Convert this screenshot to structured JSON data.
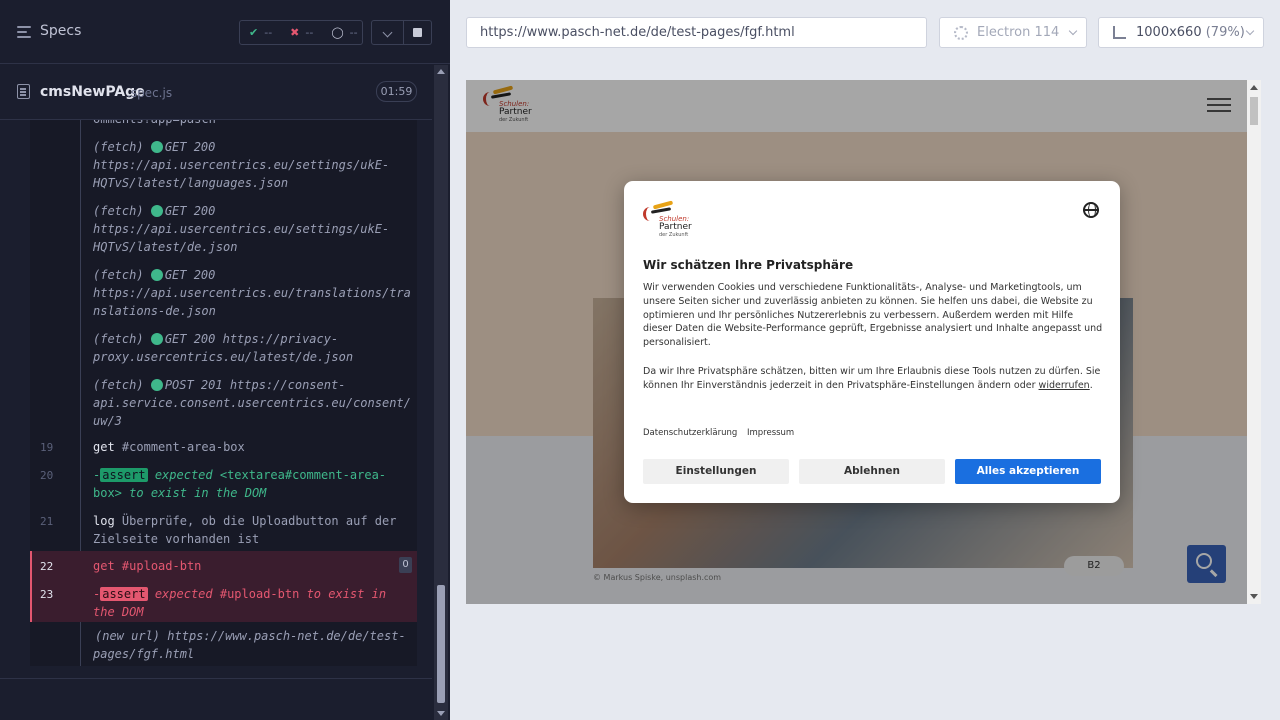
{
  "runner": {
    "specs_label": "Specs",
    "stats": {
      "passed": "--",
      "failed": "--",
      "pending": "--"
    },
    "spec_file": {
      "name": "cmsNewPAge",
      "ext": ".spec.js",
      "duration": "01:59"
    }
  },
  "log": {
    "l0": "omments?app=pasch",
    "fetch1a": "(fetch)",
    "fetch1b": "GET 200",
    "fetch1c": "https://api.usercentrics.eu/settings/ukE-",
    "fetch1d": "HQTvS/latest/languages.json",
    "fetch2b": "GET 200",
    "fetch2c": "https://api.usercentrics.eu/settings/ukE-",
    "fetch2d": "HQTvS/latest/de.json",
    "fetch3b": "GET 200",
    "fetch3c": "https://api.usercentrics.eu/translations/tra",
    "fetch3d": "nslations-de.json",
    "fetch4b": "GET 200 https://privacy-",
    "fetch4c": "proxy.usercentrics.eu/latest/de.json",
    "fetch5b": "POST 201 https://consent-",
    "fetch5c": "api.service.consent.usercentrics.eu/consent/",
    "fetch5d": "uw/3",
    "n19": "19",
    "c19a": "get",
    "c19b": "#comment-area-box",
    "n20": "20",
    "c20dash": "-",
    "c20tag": "assert",
    "c20a": "expected",
    "c20b": "<textarea#comment-area-",
    "c20c": "box>",
    "c20d": "to exist in the DOM",
    "n21": "21",
    "c21a": "log",
    "c21b": "Überprüfe, ob die Uploadbutton auf der",
    "c21c": "Zielseite vorhanden ist",
    "n22": "22",
    "c22a": "get",
    "c22b": "#upload-btn",
    "c22badge": "0",
    "n23": "23",
    "c23dash": "-",
    "c23tag": "assert",
    "c23a": "expected",
    "c23b": "#upload-btn",
    "c23c": "to exist in",
    "c23d": "the DOM",
    "newurl_a": "(new url)",
    "newurl_b": "https://www.pasch-net.de/de/test-",
    "newurl_c": "pages/fgf.html"
  },
  "browser": {
    "url": "https://www.pasch-net.de/de/test-pages/fgf.html",
    "browser_name": "Electron 114",
    "viewport": "1000x660",
    "zoom": "(79%)"
  },
  "site": {
    "logo": {
      "l1": "Schulen:",
      "l2": "Partner",
      "l3": "der Zukunft"
    },
    "photo_credit": "© Markus Spiske, unsplash.com",
    "badge": "B2"
  },
  "consent": {
    "title": "Wir schätzen Ihre Privatsphäre",
    "p1": "Wir verwenden Cookies und verschiedene Funktionalitäts-, Analyse- und Marketingtools, um unsere Seiten sicher und zuverlässig anbieten zu können. Sie helfen uns dabei, die Website zu optimieren und Ihr persönliches Nutzererlebnis zu verbessern. Außerdem werden mit Hilfe dieser Daten die Website-Performance geprüft, Ergebnisse analysiert und Inhalte angepasst und personalisiert.",
    "p2a": "Da wir Ihre Privatsphäre schätzen, bitten wir um Ihre Erlaubnis diese Tools nutzen zu dürfen. Sie können Ihr Einverständnis jederzeit in den Privatsphäre-Einstellungen ändern oder",
    "p2link": "widerrufen",
    "p2end": ".",
    "link_privacy": "Datenschutzerklärung",
    "link_imprint": "Impressum",
    "btn_settings": "Einstellungen",
    "btn_decline": "Ablehnen",
    "btn_accept": "Alles akzeptieren"
  },
  "colors": {
    "pass": "#3fb88b",
    "fail": "#e45770",
    "accept": "#1a6fe0"
  }
}
